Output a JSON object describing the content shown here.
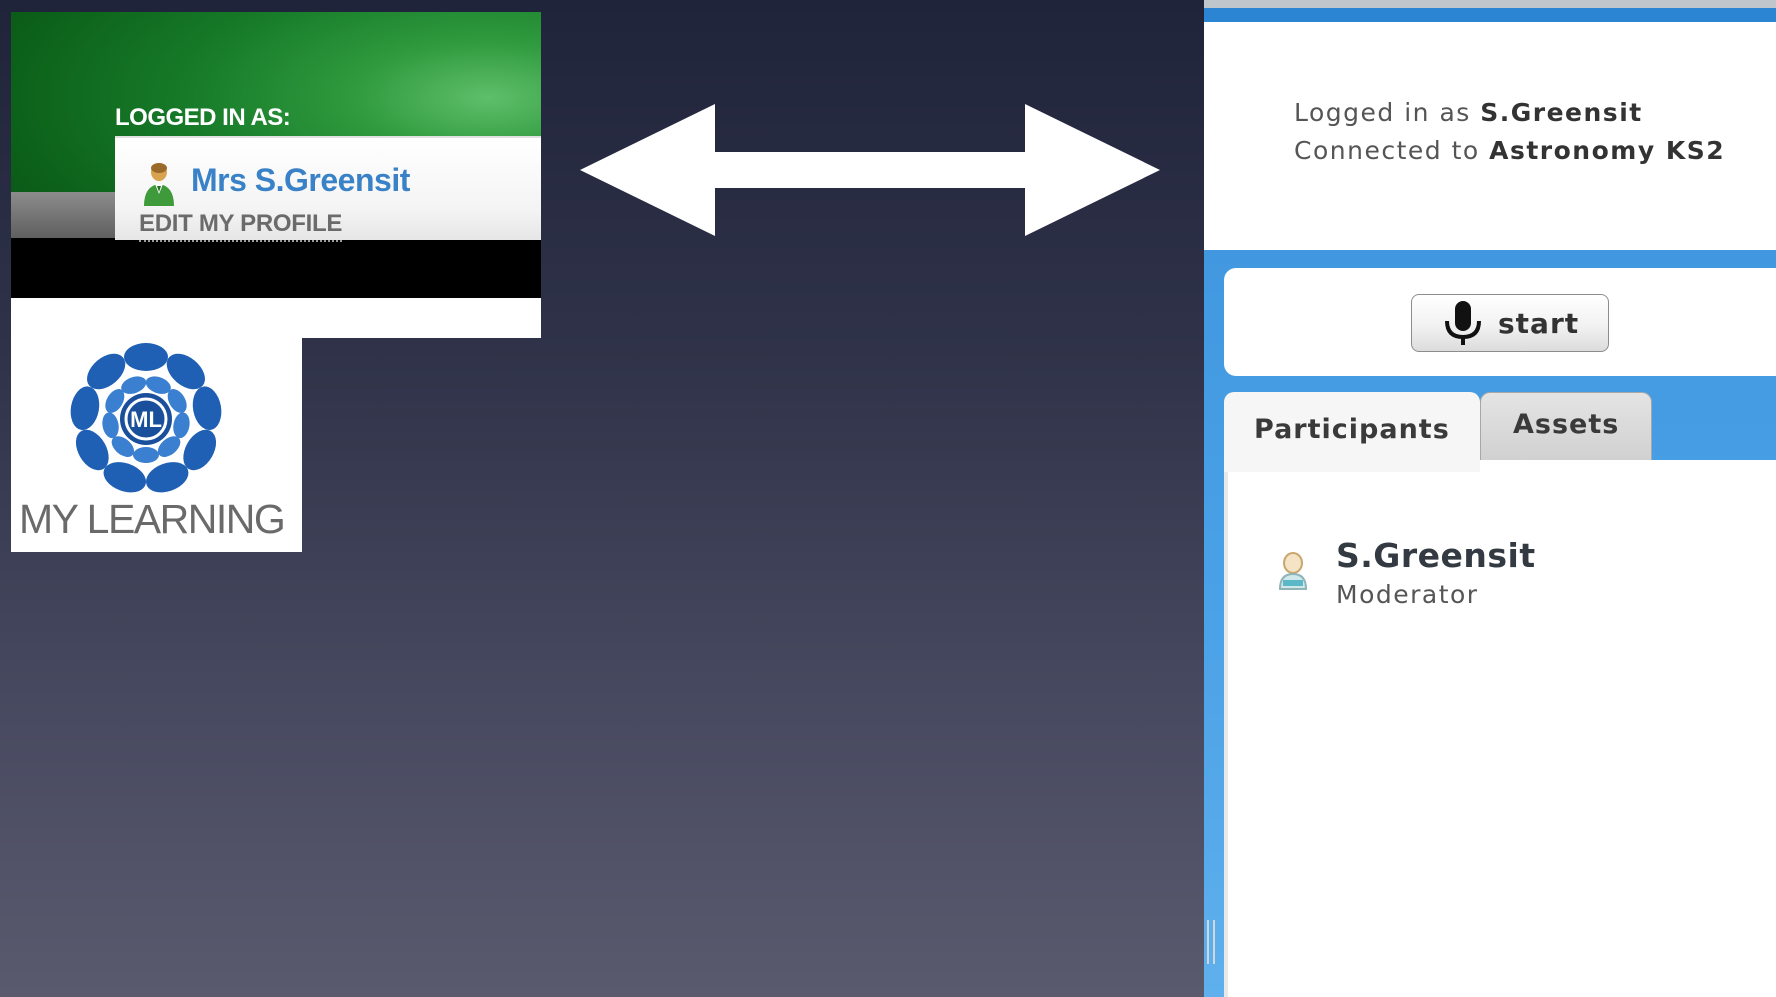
{
  "my_learning": {
    "logged_in_label": "LOGGED IN AS:",
    "user_name": "Mrs S.Greensit",
    "edit_profile": "EDIT MY PROFILE",
    "logo_text": "MY LEARNING",
    "logo_letter": "ML"
  },
  "bigbluebutton": {
    "logged_in_prefix": "Logged in as ",
    "logged_in_user": "S.Greensit",
    "connected_prefix": "Connected to ",
    "connected_room": "Astronomy KS2",
    "start_label": "start",
    "tabs": [
      {
        "label": "Participants",
        "active": true
      },
      {
        "label": "Assets",
        "active": false
      }
    ],
    "participants": [
      {
        "name": "S.Greensit",
        "role": "Moderator"
      }
    ]
  },
  "colors": {
    "ml_green": "#167a28",
    "ml_name_blue": "#3a82c7",
    "bbb_blue": "#3b92dc",
    "logo_blue": "#1f5fb4",
    "arrow": "#ffffff"
  },
  "icons": [
    "user-icon",
    "double-arrow-icon",
    "microphone-icon",
    "participant-icon",
    "my-learning-flower-logo"
  ]
}
